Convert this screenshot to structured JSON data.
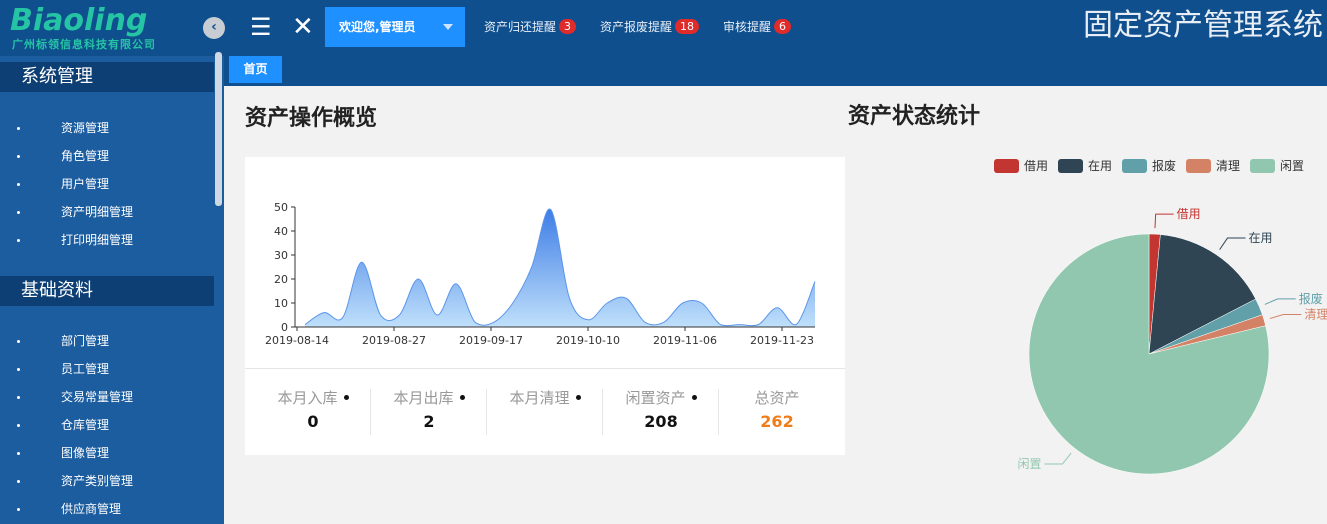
{
  "brand": {
    "name": "Biaoling",
    "subtitle": "广州标领信息科技有限公司"
  },
  "header": {
    "collapse_glyph": "‹",
    "menu_glyph": "☰",
    "close_glyph": "✕",
    "welcome": "欢迎您,管理员",
    "notices": [
      {
        "label": "资产归还提醒",
        "count": "3"
      },
      {
        "label": "资产报废提醒",
        "count": "18"
      },
      {
        "label": "审核提醒",
        "count": "6"
      }
    ],
    "system_title": "固定资产管理系统"
  },
  "sidebar": {
    "sections": [
      {
        "title": "系统管理",
        "items": [
          "资源管理",
          "角色管理",
          "用户管理",
          "资产明细管理",
          "打印明细管理"
        ]
      },
      {
        "title": "基础资料",
        "items": [
          "部门管理",
          "员工管理",
          "交易常量管理",
          "仓库管理",
          "图像管理",
          "资产类别管理",
          "供应商管理"
        ]
      }
    ]
  },
  "tabs": {
    "home": "首页"
  },
  "overview": {
    "title": "资产操作概览",
    "stats": [
      {
        "label": "本月入库",
        "value": "0"
      },
      {
        "label": "本月出库",
        "value": "2"
      },
      {
        "label": "本月清理",
        "value": ""
      },
      {
        "label": "闲置资产",
        "value": "208"
      },
      {
        "label": "总资产",
        "value": "262"
      }
    ]
  },
  "status": {
    "title": "资产状态统计"
  },
  "colors": {
    "accent": "#1e90ff",
    "header": "#0f4f8e",
    "sidebar": "#1c5da0",
    "badge": "#e02b2b",
    "total": "#f07d1a"
  },
  "chart_data": [
    {
      "type": "area",
      "title": "",
      "xlabel": "",
      "ylabel": "",
      "ylim": [
        0,
        50
      ],
      "yticks": [
        0,
        10,
        20,
        30,
        40,
        50
      ],
      "x_tick_labels": [
        "2019-08-14",
        "2019-08-27",
        "2019-09-17",
        "2019-10-10",
        "2019-11-06",
        "2019-11-23"
      ],
      "grid": false,
      "series": [
        {
          "values": [
            1,
            6,
            4,
            27,
            5,
            5,
            20,
            5,
            18,
            2,
            2,
            10,
            25,
            49,
            12,
            3,
            10,
            12,
            2,
            2,
            10,
            10,
            1,
            1,
            1,
            8,
            1,
            19
          ]
        }
      ]
    },
    {
      "type": "pie",
      "title": "",
      "legend_position": "top-right",
      "slices": [
        {
          "label": "借用",
          "value": 4,
          "color": "#c23531"
        },
        {
          "label": "在用",
          "value": 42,
          "color": "#2f4554"
        },
        {
          "label": "报废",
          "value": 6,
          "color": "#61a0a8"
        },
        {
          "label": "清理",
          "value": 4,
          "color": "#d48265"
        },
        {
          "label": "闲置",
          "value": 208,
          "color": "#91c7ae"
        }
      ]
    }
  ]
}
